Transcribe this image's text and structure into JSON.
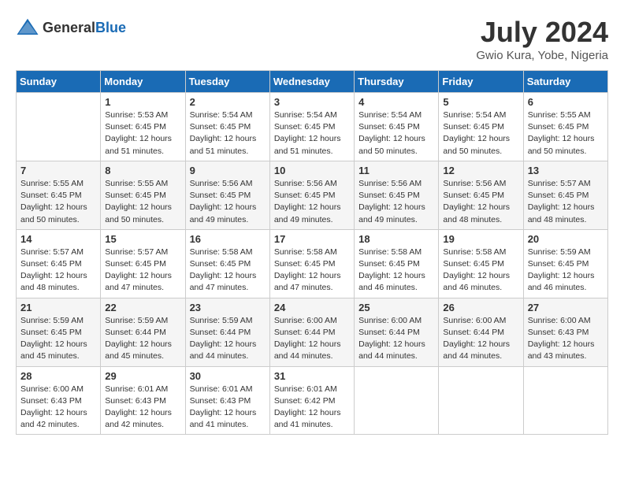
{
  "header": {
    "logo_general": "General",
    "logo_blue": "Blue",
    "month": "July 2024",
    "location": "Gwio Kura, Yobe, Nigeria"
  },
  "days_of_week": [
    "Sunday",
    "Monday",
    "Tuesday",
    "Wednesday",
    "Thursday",
    "Friday",
    "Saturday"
  ],
  "weeks": [
    [
      {
        "day": "",
        "sunrise": "",
        "sunset": "",
        "daylight": ""
      },
      {
        "day": "1",
        "sunrise": "Sunrise: 5:53 AM",
        "sunset": "Sunset: 6:45 PM",
        "daylight": "Daylight: 12 hours and 51 minutes."
      },
      {
        "day": "2",
        "sunrise": "Sunrise: 5:54 AM",
        "sunset": "Sunset: 6:45 PM",
        "daylight": "Daylight: 12 hours and 51 minutes."
      },
      {
        "day": "3",
        "sunrise": "Sunrise: 5:54 AM",
        "sunset": "Sunset: 6:45 PM",
        "daylight": "Daylight: 12 hours and 51 minutes."
      },
      {
        "day": "4",
        "sunrise": "Sunrise: 5:54 AM",
        "sunset": "Sunset: 6:45 PM",
        "daylight": "Daylight: 12 hours and 50 minutes."
      },
      {
        "day": "5",
        "sunrise": "Sunrise: 5:54 AM",
        "sunset": "Sunset: 6:45 PM",
        "daylight": "Daylight: 12 hours and 50 minutes."
      },
      {
        "day": "6",
        "sunrise": "Sunrise: 5:55 AM",
        "sunset": "Sunset: 6:45 PM",
        "daylight": "Daylight: 12 hours and 50 minutes."
      }
    ],
    [
      {
        "day": "7",
        "sunrise": "Sunrise: 5:55 AM",
        "sunset": "Sunset: 6:45 PM",
        "daylight": "Daylight: 12 hours and 50 minutes."
      },
      {
        "day": "8",
        "sunrise": "Sunrise: 5:55 AM",
        "sunset": "Sunset: 6:45 PM",
        "daylight": "Daylight: 12 hours and 50 minutes."
      },
      {
        "day": "9",
        "sunrise": "Sunrise: 5:56 AM",
        "sunset": "Sunset: 6:45 PM",
        "daylight": "Daylight: 12 hours and 49 minutes."
      },
      {
        "day": "10",
        "sunrise": "Sunrise: 5:56 AM",
        "sunset": "Sunset: 6:45 PM",
        "daylight": "Daylight: 12 hours and 49 minutes."
      },
      {
        "day": "11",
        "sunrise": "Sunrise: 5:56 AM",
        "sunset": "Sunset: 6:45 PM",
        "daylight": "Daylight: 12 hours and 49 minutes."
      },
      {
        "day": "12",
        "sunrise": "Sunrise: 5:56 AM",
        "sunset": "Sunset: 6:45 PM",
        "daylight": "Daylight: 12 hours and 48 minutes."
      },
      {
        "day": "13",
        "sunrise": "Sunrise: 5:57 AM",
        "sunset": "Sunset: 6:45 PM",
        "daylight": "Daylight: 12 hours and 48 minutes."
      }
    ],
    [
      {
        "day": "14",
        "sunrise": "Sunrise: 5:57 AM",
        "sunset": "Sunset: 6:45 PM",
        "daylight": "Daylight: 12 hours and 48 minutes."
      },
      {
        "day": "15",
        "sunrise": "Sunrise: 5:57 AM",
        "sunset": "Sunset: 6:45 PM",
        "daylight": "Daylight: 12 hours and 47 minutes."
      },
      {
        "day": "16",
        "sunrise": "Sunrise: 5:58 AM",
        "sunset": "Sunset: 6:45 PM",
        "daylight": "Daylight: 12 hours and 47 minutes."
      },
      {
        "day": "17",
        "sunrise": "Sunrise: 5:58 AM",
        "sunset": "Sunset: 6:45 PM",
        "daylight": "Daylight: 12 hours and 47 minutes."
      },
      {
        "day": "18",
        "sunrise": "Sunrise: 5:58 AM",
        "sunset": "Sunset: 6:45 PM",
        "daylight": "Daylight: 12 hours and 46 minutes."
      },
      {
        "day": "19",
        "sunrise": "Sunrise: 5:58 AM",
        "sunset": "Sunset: 6:45 PM",
        "daylight": "Daylight: 12 hours and 46 minutes."
      },
      {
        "day": "20",
        "sunrise": "Sunrise: 5:59 AM",
        "sunset": "Sunset: 6:45 PM",
        "daylight": "Daylight: 12 hours and 46 minutes."
      }
    ],
    [
      {
        "day": "21",
        "sunrise": "Sunrise: 5:59 AM",
        "sunset": "Sunset: 6:45 PM",
        "daylight": "Daylight: 12 hours and 45 minutes."
      },
      {
        "day": "22",
        "sunrise": "Sunrise: 5:59 AM",
        "sunset": "Sunset: 6:44 PM",
        "daylight": "Daylight: 12 hours and 45 minutes."
      },
      {
        "day": "23",
        "sunrise": "Sunrise: 5:59 AM",
        "sunset": "Sunset: 6:44 PM",
        "daylight": "Daylight: 12 hours and 44 minutes."
      },
      {
        "day": "24",
        "sunrise": "Sunrise: 6:00 AM",
        "sunset": "Sunset: 6:44 PM",
        "daylight": "Daylight: 12 hours and 44 minutes."
      },
      {
        "day": "25",
        "sunrise": "Sunrise: 6:00 AM",
        "sunset": "Sunset: 6:44 PM",
        "daylight": "Daylight: 12 hours and 44 minutes."
      },
      {
        "day": "26",
        "sunrise": "Sunrise: 6:00 AM",
        "sunset": "Sunset: 6:44 PM",
        "daylight": "Daylight: 12 hours and 44 minutes."
      },
      {
        "day": "27",
        "sunrise": "Sunrise: 6:00 AM",
        "sunset": "Sunset: 6:43 PM",
        "daylight": "Daylight: 12 hours and 43 minutes."
      }
    ],
    [
      {
        "day": "28",
        "sunrise": "Sunrise: 6:00 AM",
        "sunset": "Sunset: 6:43 PM",
        "daylight": "Daylight: 12 hours and 42 minutes."
      },
      {
        "day": "29",
        "sunrise": "Sunrise: 6:01 AM",
        "sunset": "Sunset: 6:43 PM",
        "daylight": "Daylight: 12 hours and 42 minutes."
      },
      {
        "day": "30",
        "sunrise": "Sunrise: 6:01 AM",
        "sunset": "Sunset: 6:43 PM",
        "daylight": "Daylight: 12 hours and 41 minutes."
      },
      {
        "day": "31",
        "sunrise": "Sunrise: 6:01 AM",
        "sunset": "Sunset: 6:42 PM",
        "daylight": "Daylight: 12 hours and 41 minutes."
      },
      {
        "day": "",
        "sunrise": "",
        "sunset": "",
        "daylight": ""
      },
      {
        "day": "",
        "sunrise": "",
        "sunset": "",
        "daylight": ""
      },
      {
        "day": "",
        "sunrise": "",
        "sunset": "",
        "daylight": ""
      }
    ]
  ]
}
